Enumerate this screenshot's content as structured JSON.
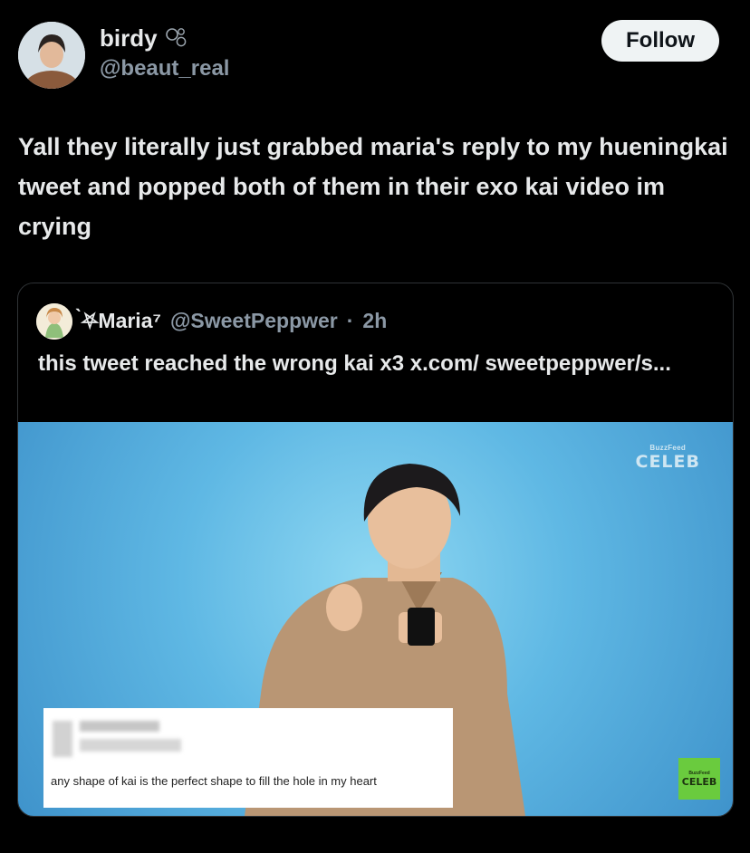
{
  "author": {
    "display_name": "birdy",
    "handle": "@beaut_real",
    "badge_icon": "bubbles-icon"
  },
  "follow_label": "Follow",
  "tweet_text": "Yall they literally just grabbed maria's reply to my hueningkai tweet and popped both of them in their exo kai video im crying",
  "quote": {
    "name_prefix": "̀⛧",
    "name": "Maria⁷",
    "handle": "@SweetPeppwer",
    "separator": "·",
    "time": "2h",
    "text": "this tweet reached the wrong kai x3 x.com/ sweetpeppwer/s..."
  },
  "media": {
    "watermark_small": "BuzzFeed",
    "watermark_big": "CELEB",
    "badge_small": "BuzzFeed",
    "badge_big": "CELEB",
    "caption": "any shape of kai is the perfect shape to fill the hole in my heart"
  },
  "colors": {
    "background": "#000000",
    "text": "#e7e9ea",
    "muted": "#8b98a5",
    "follow_bg": "#eff3f4",
    "media_bg": "#5fb8e4",
    "badge": "#6acb3e"
  }
}
